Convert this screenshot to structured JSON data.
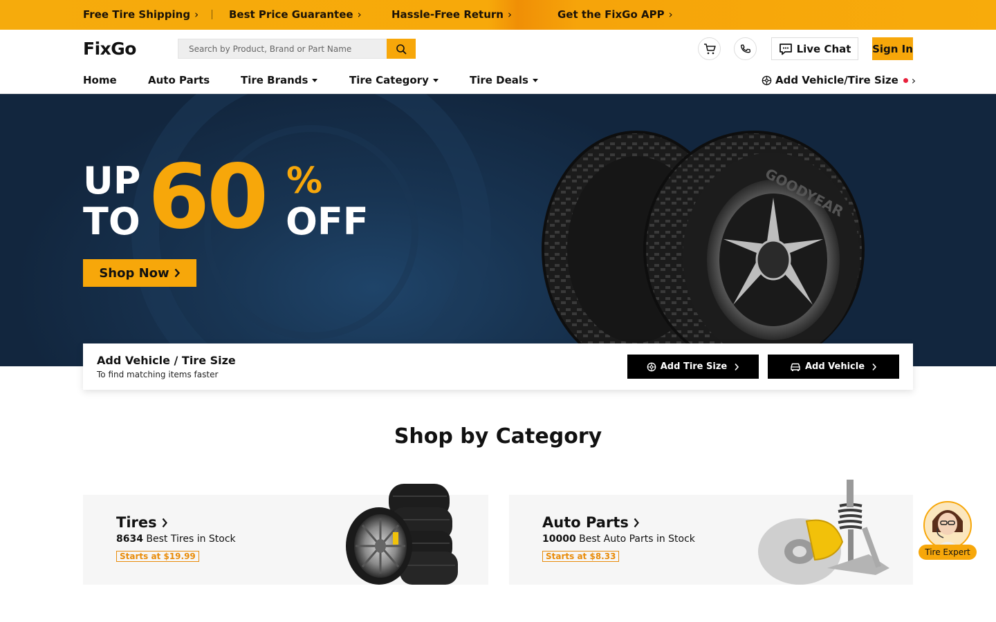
{
  "promo_bar": {
    "items": [
      "Free Tire Shipping",
      "Best Price Guarantee",
      "Hassle-Free Return",
      "Get the FixGo APP"
    ],
    "chevron": "›"
  },
  "header": {
    "logo": "FixGo",
    "search_placeholder": "Search by Product, Brand or Part Name",
    "live_chat": "Live Chat",
    "sign_in": "Sign In"
  },
  "nav": {
    "items": [
      {
        "label": "Home",
        "has_dropdown": false
      },
      {
        "label": "Auto Parts",
        "has_dropdown": false
      },
      {
        "label": "Tire Brands",
        "has_dropdown": true
      },
      {
        "label": "Tire Category",
        "has_dropdown": true
      },
      {
        "label": "Tire Deals",
        "has_dropdown": true
      }
    ],
    "add_vehicle": "Add Vehicle/Tire Size",
    "chevron": "›"
  },
  "hero": {
    "line1": "UP",
    "line2": "TO",
    "number": "60",
    "percent": "%",
    "off": "OFF",
    "cta": "Shop Now",
    "tire_brand": "GOODYEAR"
  },
  "vehicle_card": {
    "title": "Add Vehicle / Tire Size",
    "subtitle": "To find matching items faster",
    "add_tire_size": "Add Tire Size",
    "add_vehicle": "Add Vehicle"
  },
  "category": {
    "heading": "Shop by Category",
    "cards": [
      {
        "title": "Tires",
        "count": "8634",
        "count_text": "Best Tires in Stock",
        "price": "Starts at $19.99"
      },
      {
        "title": "Auto Parts",
        "count": "10000",
        "count_text": "Best Auto Parts in Stock",
        "price": "Starts at $8.33"
      }
    ]
  },
  "expert_widget": {
    "label": "Tire Expert"
  },
  "colors": {
    "accent": "#f7a70a",
    "hero_bg": "#183452",
    "dark_button": "#000000",
    "notify_dot": "#e8213c"
  }
}
